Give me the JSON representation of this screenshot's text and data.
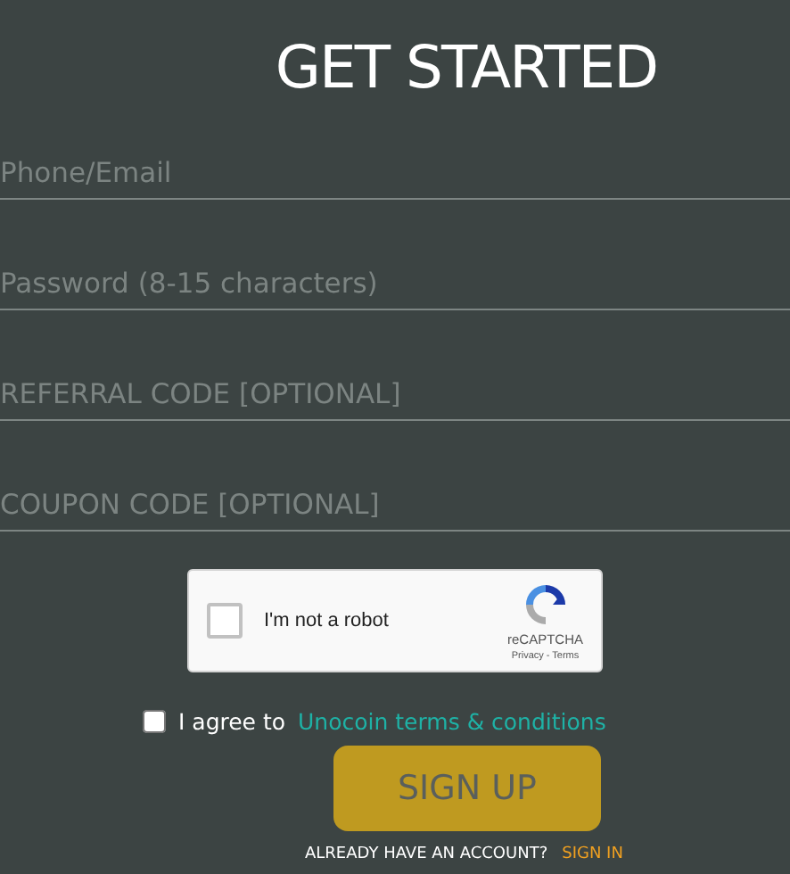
{
  "title": "GET STARTED",
  "fields": [
    {
      "placeholder": "Phone/Email"
    },
    {
      "placeholder": "Password (8-15 characters)"
    },
    {
      "placeholder": "REFERRAL CODE [OPTIONAL]"
    },
    {
      "placeholder": "COUPON CODE [OPTIONAL]"
    }
  ],
  "captcha": {
    "label": "I'm not a robot",
    "checked": false,
    "brand": "reCAPTCHA",
    "links": "Privacy - Terms"
  },
  "agree": {
    "checked": false,
    "text": "I agree to",
    "link": "Unocoin terms & conditions"
  },
  "button": "SIGN UP",
  "footer": {
    "text": "ALREADY HAVE AN ACCOUNT?",
    "link": "SIGN IN"
  }
}
